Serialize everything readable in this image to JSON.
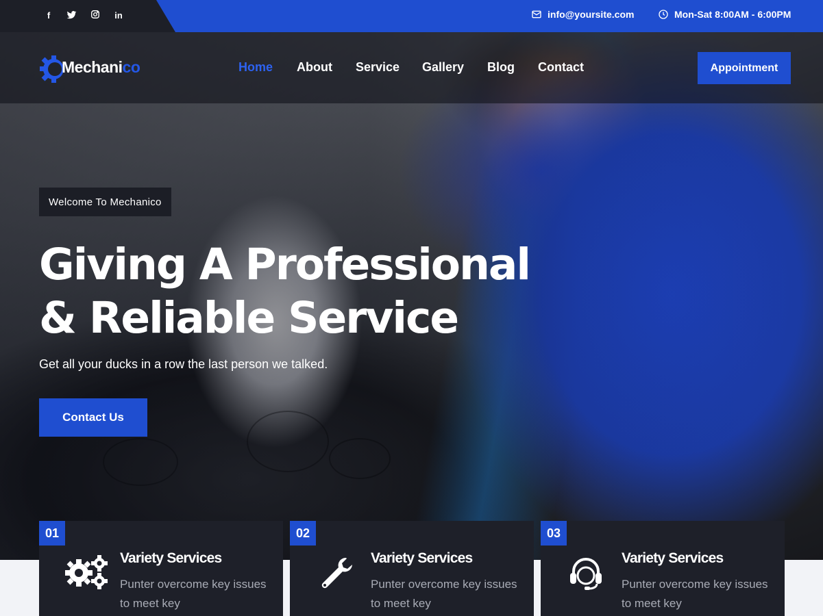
{
  "topbar": {
    "social": [
      {
        "icon": "facebook-icon",
        "glyph": "f"
      },
      {
        "icon": "twitter-icon",
        "glyph": ""
      },
      {
        "icon": "instagram-icon",
        "glyph": ""
      },
      {
        "icon": "linkedin-icon",
        "glyph": "in"
      }
    ],
    "email": "info@yoursite.com",
    "hours": "Mon-Sat 8:00AM - 6:00PM"
  },
  "logo": {
    "text_main": "Mechani",
    "text_accent": "co",
    "icon": "gear-icon"
  },
  "nav": {
    "items": [
      {
        "label": "Home",
        "active": true
      },
      {
        "label": "About",
        "active": false
      },
      {
        "label": "Service",
        "active": false
      },
      {
        "label": "Gallery",
        "active": false
      },
      {
        "label": "Blog",
        "active": false
      },
      {
        "label": "Contact",
        "active": false
      }
    ],
    "cta": "Appointment"
  },
  "hero": {
    "tag": "Welcome To Mechanico",
    "headline_line1": "Giving A Professional",
    "headline_line2": "& Reliable Service",
    "subtext": "Get all your ducks in a row the last person we talked.",
    "cta": "Contact Us"
  },
  "cards": [
    {
      "number": "01",
      "icon": "gears-icon",
      "title": "Variety Services",
      "desc": "Punter overcome key issues to meet key"
    },
    {
      "number": "02",
      "icon": "wrench-icon",
      "title": "Variety Services",
      "desc": "Punter overcome key issues to meet key"
    },
    {
      "number": "03",
      "icon": "headset-icon",
      "title": "Variety Services",
      "desc": "Punter overcome key issues to meet key"
    }
  ],
  "colors": {
    "brand_blue": "#1f4ed0",
    "dark": "#1e2029",
    "active_nav": "#2d62f0"
  }
}
